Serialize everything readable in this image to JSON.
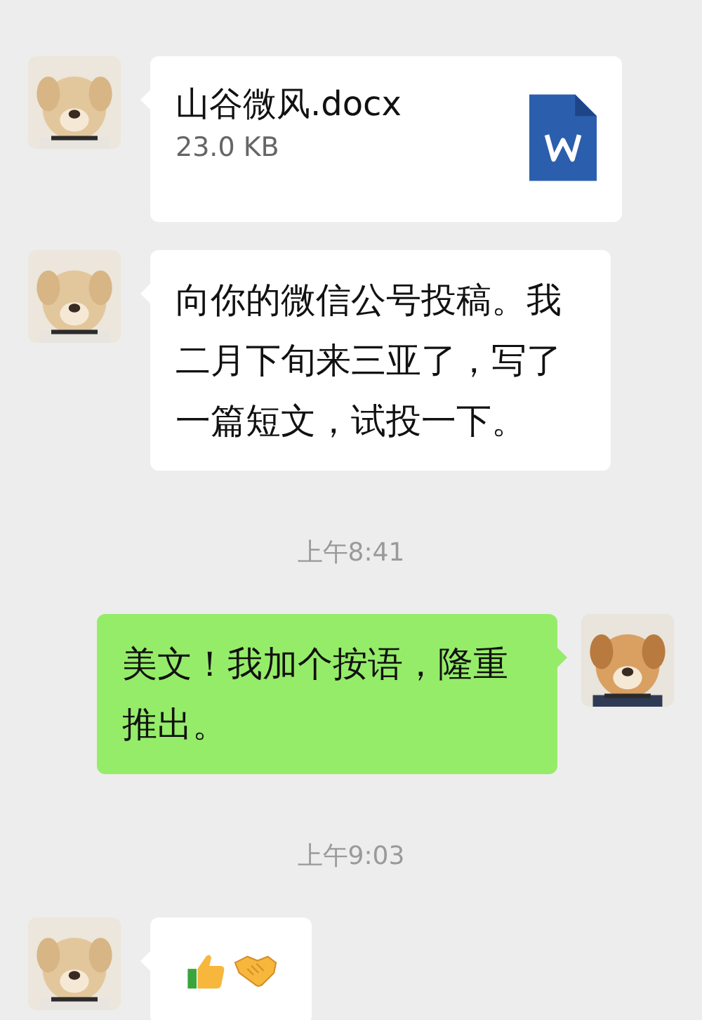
{
  "messages": [
    {
      "kind": "file",
      "outgoing": false,
      "file_name": "山谷微风.docx",
      "file_size": "23.0 KB"
    },
    {
      "kind": "text",
      "outgoing": false,
      "text": "向你的微信公号投稿。我二月下旬来三亚了，写了一篇短文，试投一下。"
    },
    {
      "kind": "time",
      "text": "上午8:41"
    },
    {
      "kind": "text",
      "outgoing": true,
      "text": "美文！我加个按语，隆重推出。"
    },
    {
      "kind": "time",
      "text": "上午9:03"
    },
    {
      "kind": "emoji",
      "outgoing": false
    }
  ]
}
